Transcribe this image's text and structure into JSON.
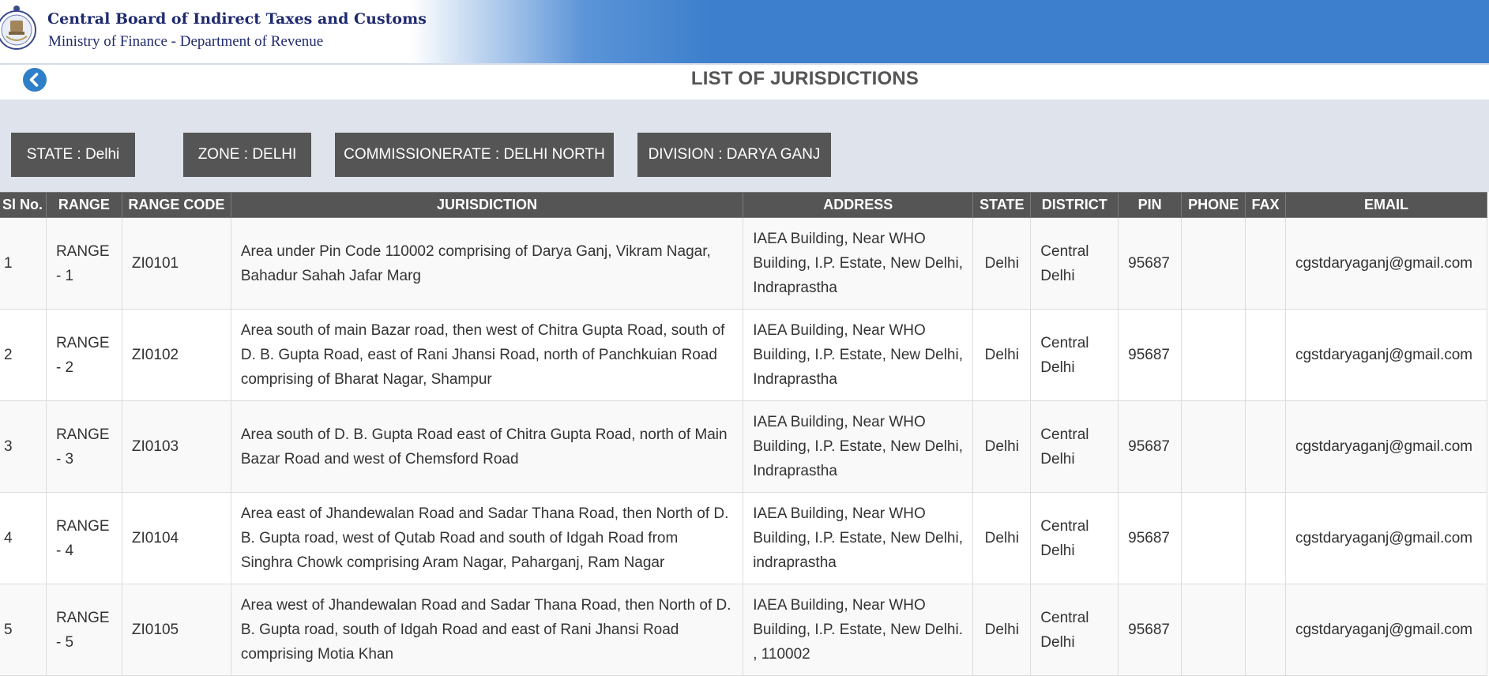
{
  "header": {
    "org_name": "Central Board of Indirect Taxes and Customs",
    "org_subtitle": "Ministry of Finance - Department of Revenue",
    "banner_color": "#3d7fcc",
    "title_color": "#1f2a6e"
  },
  "page": {
    "title": "LIST OF JURISDICTIONS",
    "back_icon": "chevron-left-circle-icon"
  },
  "filters": [
    {
      "label": "STATE : Delhi"
    },
    {
      "label": "ZONE : DELHI"
    },
    {
      "label": "COMMISSIONERATE : DELHI NORTH"
    },
    {
      "label": "DIVISION : DARYA GANJ"
    }
  ],
  "table": {
    "headers": [
      "Sl No.",
      "RANGE",
      "RANGE CODE",
      "JURISDICTION",
      "ADDRESS",
      "STATE",
      "DISTRICT",
      "PIN",
      "PHONE",
      "FAX",
      "EMAIL"
    ],
    "rows": [
      {
        "sl": "1",
        "range": "RANGE - 1",
        "code": "ZI0101",
        "jurisdiction": "Area under Pin Code 110002 comprising of Darya Ganj, Vikram Nagar, Bahadur Sahah Jafar Marg",
        "address": "IAEA Building, Near WHO Building, I.P. Estate, New Delhi, Indraprastha",
        "state": "Delhi",
        "district": "Central Delhi",
        "pin": "95687",
        "phone": "",
        "fax": "",
        "email": "cgstdaryaganj@gmail.com"
      },
      {
        "sl": "2",
        "range": "RANGE - 2",
        "code": "ZI0102",
        "jurisdiction": "Area south of main Bazar road, then west of Chitra Gupta Road, south of D. B. Gupta Road, east of Rani Jhansi Road, north of Panchkuian Road comprising of Bharat Nagar, Shampur",
        "address": "IAEA Building, Near WHO Building, I.P. Estate, New Delhi, Indraprastha",
        "state": "Delhi",
        "district": "Central Delhi",
        "pin": "95687",
        "phone": "",
        "fax": "",
        "email": "cgstdaryaganj@gmail.com"
      },
      {
        "sl": "3",
        "range": "RANGE - 3",
        "code": "ZI0103",
        "jurisdiction": "Area south of D. B. Gupta Road east of Chitra Gupta Road, north of Main Bazar Road and west of Chemsford Road",
        "address": "IAEA Building, Near WHO Building, I.P. Estate, New Delhi, Indraprastha",
        "state": "Delhi",
        "district": "Central Delhi",
        "pin": "95687",
        "phone": "",
        "fax": "",
        "email": "cgstdaryaganj@gmail.com"
      },
      {
        "sl": "4",
        "range": "RANGE - 4",
        "code": "ZI0104",
        "jurisdiction": "Area east of Jhandewalan Road and Sadar Thana Road, then North of D. B. Gupta road, west of Qutab Road and south of Idgah Road from Singhra Chowk comprising Aram Nagar, Paharganj, Ram Nagar",
        "address": "IAEA Building, Near WHO Building, I.P. Estate, New Delhi, indraprastha",
        "state": "Delhi",
        "district": "Central Delhi",
        "pin": "95687",
        "phone": "",
        "fax": "",
        "email": "cgstdaryaganj@gmail.com"
      },
      {
        "sl": "5",
        "range": "RANGE - 5",
        "code": "ZI0105",
        "jurisdiction": "Area west of Jhandewalan Road and Sadar Thana Road, then North of D. B. Gupta road, south of Idgah Road and east of Rani Jhansi Road comprising Motia Khan",
        "address": "IAEA Building, Near WHO Building, I.P. Estate, New Delhi. , 110002",
        "state": "Delhi",
        "district": "Central Delhi",
        "pin": "95687",
        "phone": "",
        "fax": "",
        "email": "cgstdaryaganj@gmail.com"
      }
    ]
  }
}
